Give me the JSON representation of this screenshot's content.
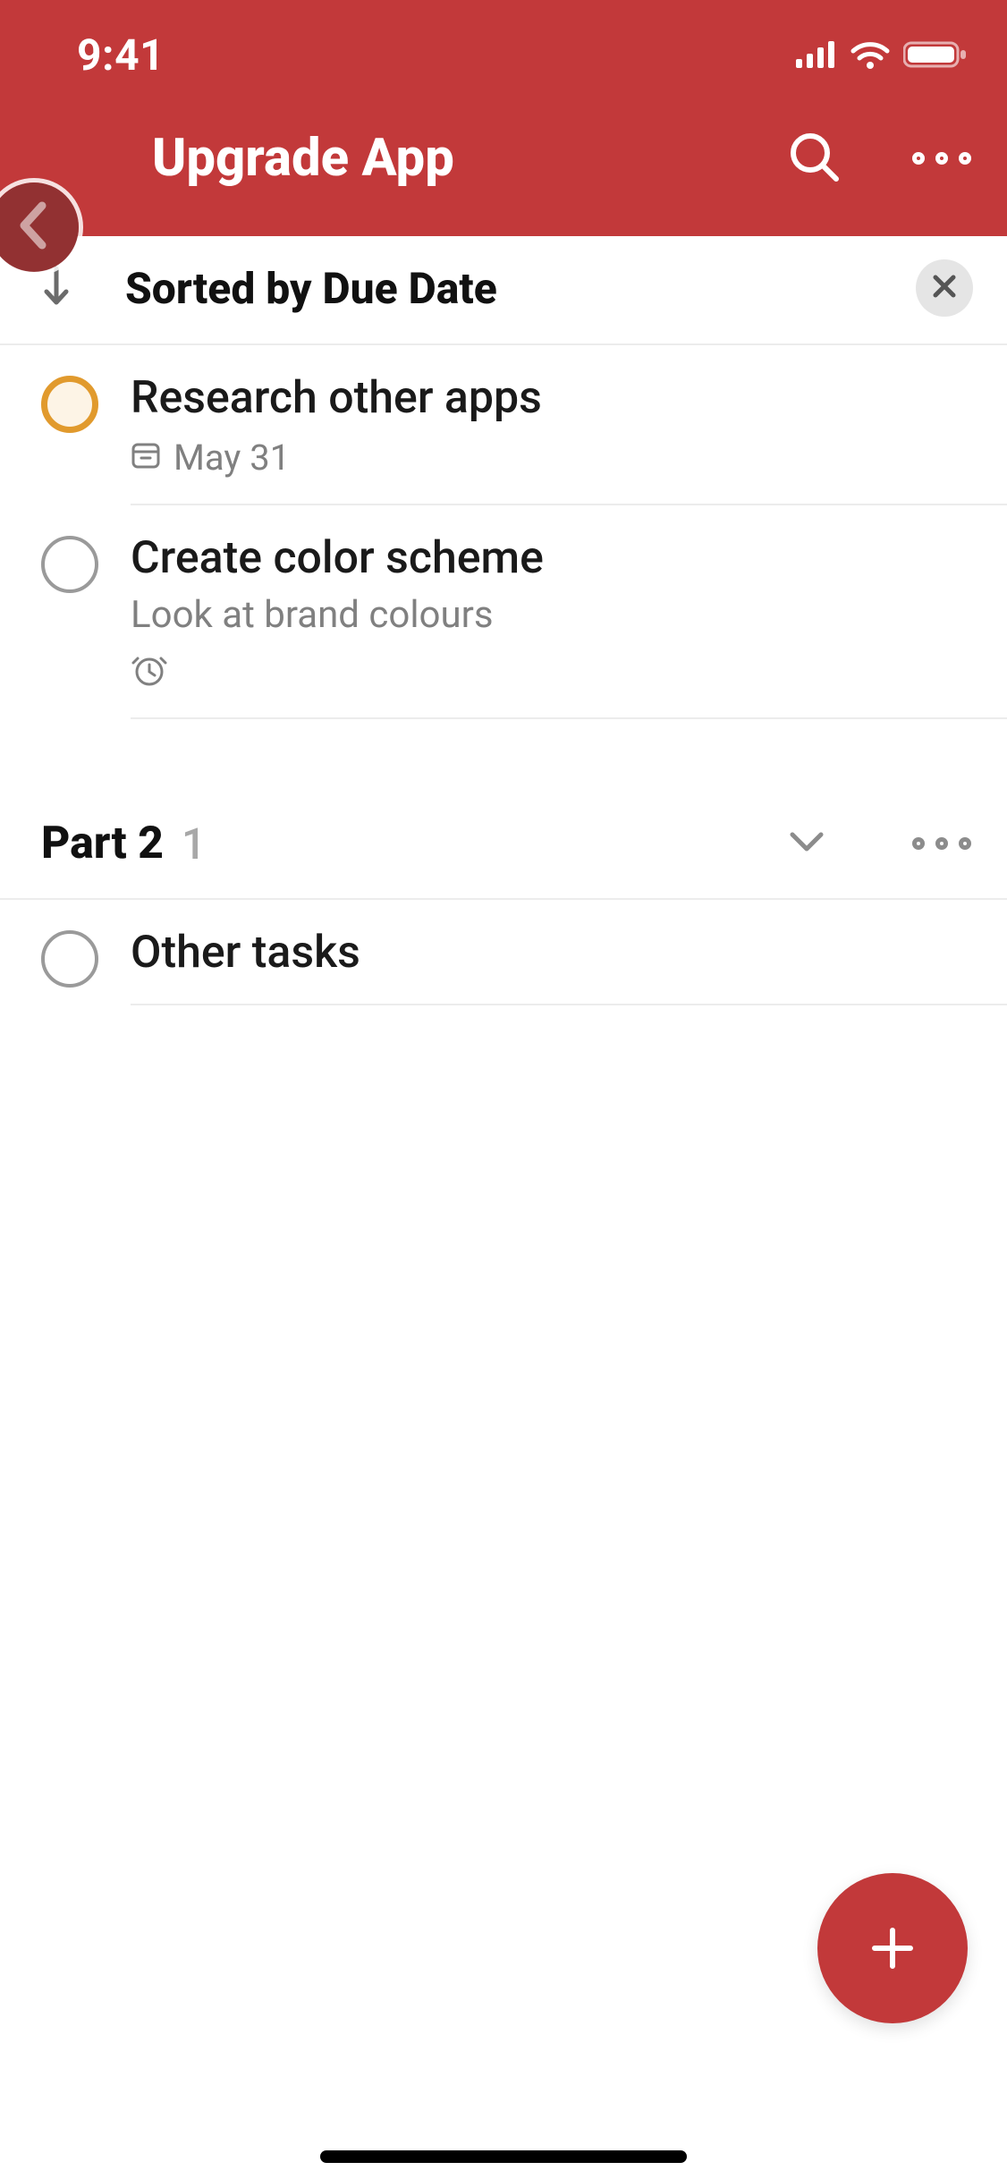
{
  "statusbar": {
    "time": "9:41"
  },
  "header": {
    "title": "Upgrade App"
  },
  "sort": {
    "label": "Sorted by Due Date"
  },
  "tasks": [
    {
      "title": "Research other apps",
      "due_text": "May 31",
      "note": "",
      "priority": "p1",
      "has_calendar": true,
      "has_reminder": false
    },
    {
      "title": "Create color scheme",
      "due_text": "",
      "note": "Look at brand colours",
      "priority": "normal",
      "has_calendar": false,
      "has_reminder": true
    }
  ],
  "sections": [
    {
      "name": "Part 2",
      "count": "1",
      "tasks": [
        {
          "title": "Other tasks",
          "due_text": "",
          "note": "",
          "priority": "normal",
          "has_calendar": false,
          "has_reminder": false
        }
      ]
    }
  ],
  "colors": {
    "brand": "#c2393a",
    "orange": "#e19a2d",
    "grey_text": "#808080"
  }
}
